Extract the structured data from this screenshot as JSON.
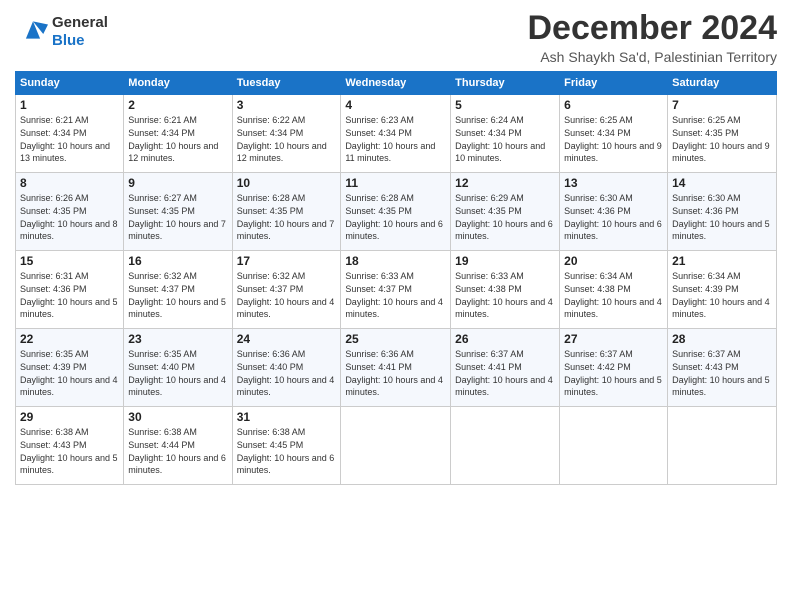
{
  "logo": {
    "line1": "General",
    "line2": "Blue"
  },
  "title": "December 2024",
  "subtitle": "Ash Shaykh Sa'd, Palestinian Territory",
  "days_header": [
    "Sunday",
    "Monday",
    "Tuesday",
    "Wednesday",
    "Thursday",
    "Friday",
    "Saturday"
  ],
  "weeks": [
    [
      {
        "day": "1",
        "sunrise": "6:21 AM",
        "sunset": "4:34 PM",
        "daylight": "10 hours and 13 minutes."
      },
      {
        "day": "2",
        "sunrise": "6:21 AM",
        "sunset": "4:34 PM",
        "daylight": "10 hours and 12 minutes."
      },
      {
        "day": "3",
        "sunrise": "6:22 AM",
        "sunset": "4:34 PM",
        "daylight": "10 hours and 12 minutes."
      },
      {
        "day": "4",
        "sunrise": "6:23 AM",
        "sunset": "4:34 PM",
        "daylight": "10 hours and 11 minutes."
      },
      {
        "day": "5",
        "sunrise": "6:24 AM",
        "sunset": "4:34 PM",
        "daylight": "10 hours and 10 minutes."
      },
      {
        "day": "6",
        "sunrise": "6:25 AM",
        "sunset": "4:34 PM",
        "daylight": "10 hours and 9 minutes."
      },
      {
        "day": "7",
        "sunrise": "6:25 AM",
        "sunset": "4:35 PM",
        "daylight": "10 hours and 9 minutes."
      }
    ],
    [
      {
        "day": "8",
        "sunrise": "6:26 AM",
        "sunset": "4:35 PM",
        "daylight": "10 hours and 8 minutes."
      },
      {
        "day": "9",
        "sunrise": "6:27 AM",
        "sunset": "4:35 PM",
        "daylight": "10 hours and 7 minutes."
      },
      {
        "day": "10",
        "sunrise": "6:28 AM",
        "sunset": "4:35 PM",
        "daylight": "10 hours and 7 minutes."
      },
      {
        "day": "11",
        "sunrise": "6:28 AM",
        "sunset": "4:35 PM",
        "daylight": "10 hours and 6 minutes."
      },
      {
        "day": "12",
        "sunrise": "6:29 AM",
        "sunset": "4:35 PM",
        "daylight": "10 hours and 6 minutes."
      },
      {
        "day": "13",
        "sunrise": "6:30 AM",
        "sunset": "4:36 PM",
        "daylight": "10 hours and 6 minutes."
      },
      {
        "day": "14",
        "sunrise": "6:30 AM",
        "sunset": "4:36 PM",
        "daylight": "10 hours and 5 minutes."
      }
    ],
    [
      {
        "day": "15",
        "sunrise": "6:31 AM",
        "sunset": "4:36 PM",
        "daylight": "10 hours and 5 minutes."
      },
      {
        "day": "16",
        "sunrise": "6:32 AM",
        "sunset": "4:37 PM",
        "daylight": "10 hours and 5 minutes."
      },
      {
        "day": "17",
        "sunrise": "6:32 AM",
        "sunset": "4:37 PM",
        "daylight": "10 hours and 4 minutes."
      },
      {
        "day": "18",
        "sunrise": "6:33 AM",
        "sunset": "4:37 PM",
        "daylight": "10 hours and 4 minutes."
      },
      {
        "day": "19",
        "sunrise": "6:33 AM",
        "sunset": "4:38 PM",
        "daylight": "10 hours and 4 minutes."
      },
      {
        "day": "20",
        "sunrise": "6:34 AM",
        "sunset": "4:38 PM",
        "daylight": "10 hours and 4 minutes."
      },
      {
        "day": "21",
        "sunrise": "6:34 AM",
        "sunset": "4:39 PM",
        "daylight": "10 hours and 4 minutes."
      }
    ],
    [
      {
        "day": "22",
        "sunrise": "6:35 AM",
        "sunset": "4:39 PM",
        "daylight": "10 hours and 4 minutes."
      },
      {
        "day": "23",
        "sunrise": "6:35 AM",
        "sunset": "4:40 PM",
        "daylight": "10 hours and 4 minutes."
      },
      {
        "day": "24",
        "sunrise": "6:36 AM",
        "sunset": "4:40 PM",
        "daylight": "10 hours and 4 minutes."
      },
      {
        "day": "25",
        "sunrise": "6:36 AM",
        "sunset": "4:41 PM",
        "daylight": "10 hours and 4 minutes."
      },
      {
        "day": "26",
        "sunrise": "6:37 AM",
        "sunset": "4:41 PM",
        "daylight": "10 hours and 4 minutes."
      },
      {
        "day": "27",
        "sunrise": "6:37 AM",
        "sunset": "4:42 PM",
        "daylight": "10 hours and 5 minutes."
      },
      {
        "day": "28",
        "sunrise": "6:37 AM",
        "sunset": "4:43 PM",
        "daylight": "10 hours and 5 minutes."
      }
    ],
    [
      {
        "day": "29",
        "sunrise": "6:38 AM",
        "sunset": "4:43 PM",
        "daylight": "10 hours and 5 minutes."
      },
      {
        "day": "30",
        "sunrise": "6:38 AM",
        "sunset": "4:44 PM",
        "daylight": "10 hours and 6 minutes."
      },
      {
        "day": "31",
        "sunrise": "6:38 AM",
        "sunset": "4:45 PM",
        "daylight": "10 hours and 6 minutes."
      },
      null,
      null,
      null,
      null
    ]
  ],
  "labels": {
    "sunrise": "Sunrise:",
    "sunset": "Sunset:",
    "daylight": "Daylight:"
  }
}
